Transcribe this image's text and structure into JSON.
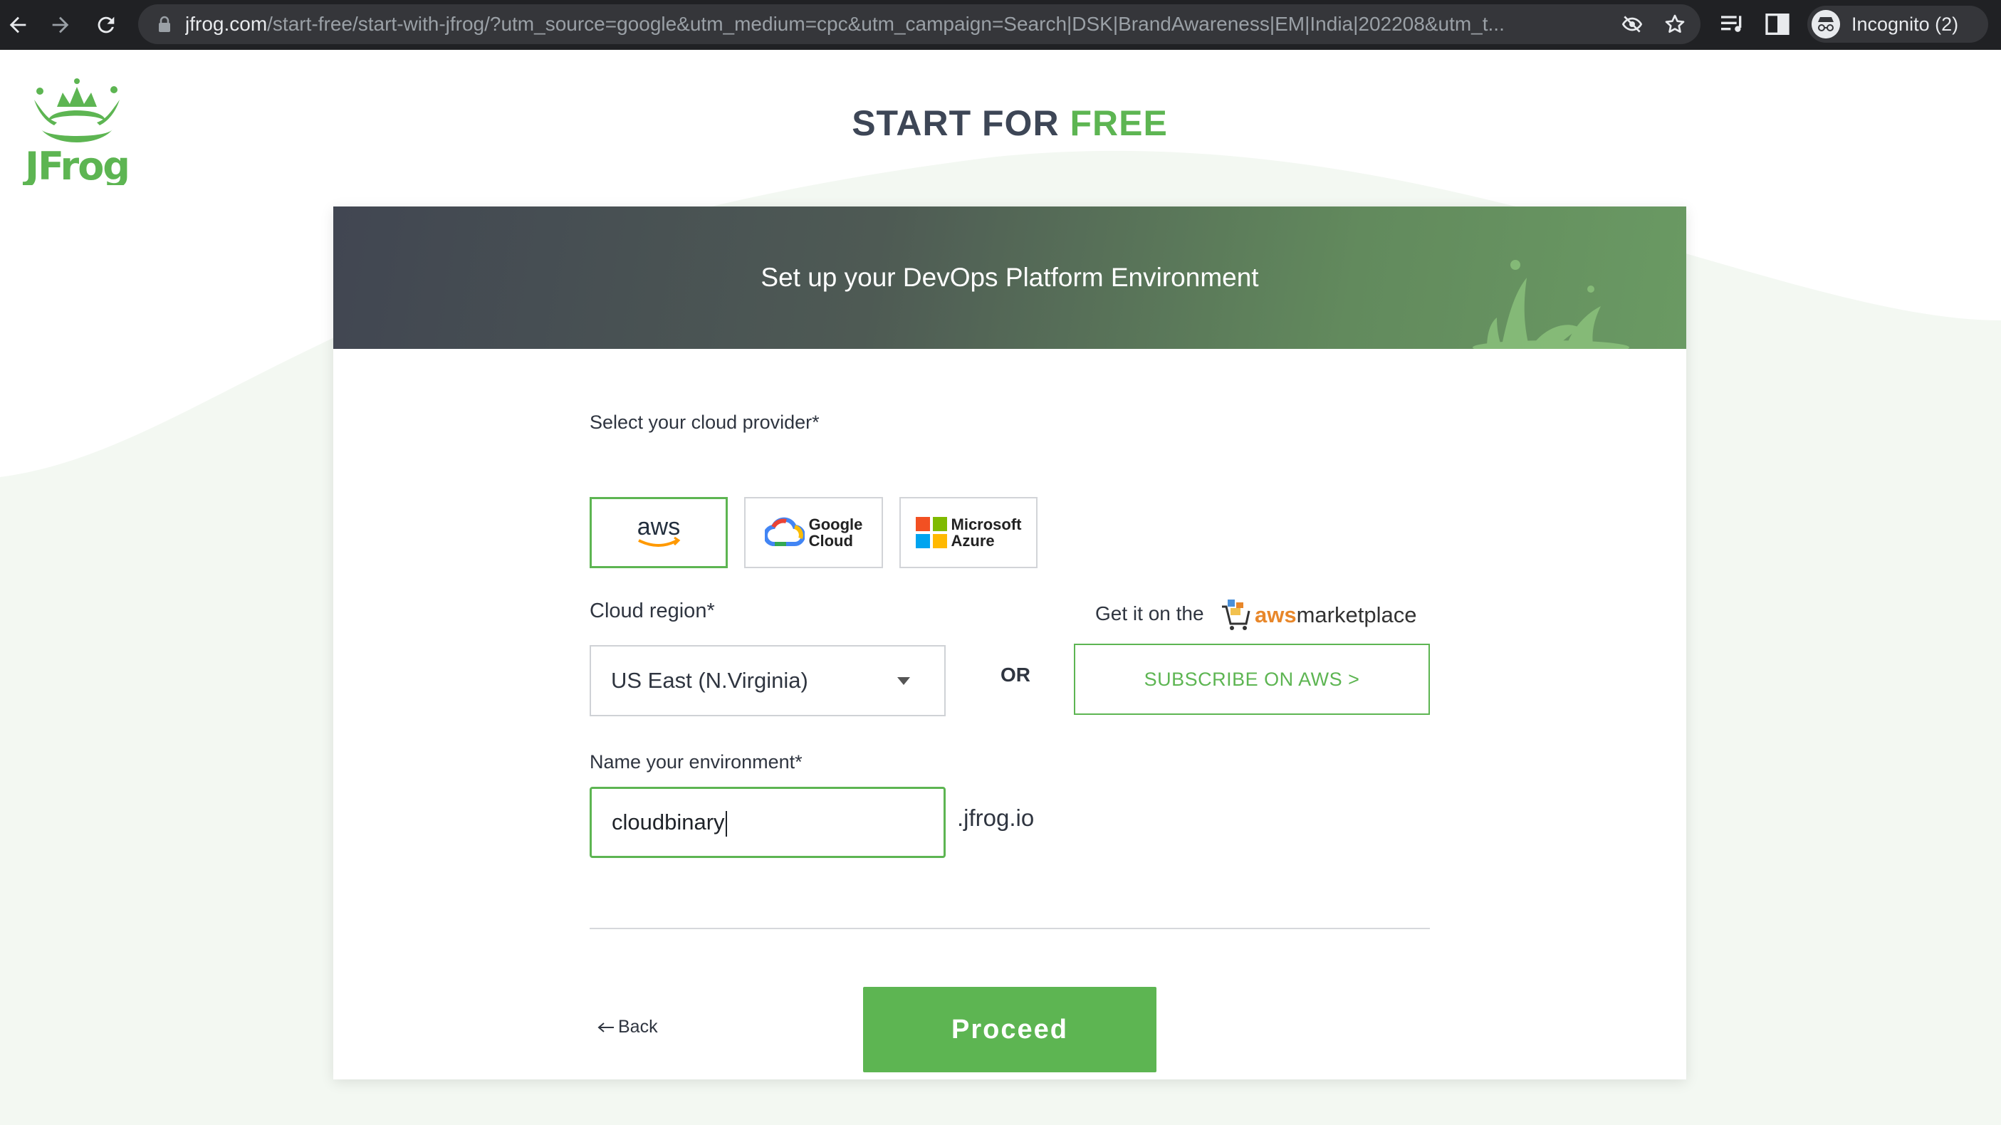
{
  "browser": {
    "url_host": "jfrog.com",
    "url_path": "/start-free/start-with-jfrog/?utm_source=google&utm_medium=cpc&utm_campaign=Search|DSK|BrandAwareness|EM|India|202208&utm_t...",
    "profile_label": "Incognito (2)"
  },
  "header": {
    "logo_text": "JFrog",
    "title_part1": "START FOR ",
    "title_part2": "FREE"
  },
  "card": {
    "title": "Set up your DevOps Platform Environment"
  },
  "form": {
    "provider_label": "Select your cloud provider*",
    "providers": [
      {
        "name": "aws",
        "selected": true
      },
      {
        "line1": "Google",
        "line2": "Cloud",
        "selected": false
      },
      {
        "line1": "Microsoft",
        "line2": "Azure",
        "selected": false
      }
    ],
    "region_label": "Cloud region*",
    "region_value": "US East (N.Virginia)",
    "or_label": "OR",
    "marketplace_prefix": "Get it on the",
    "marketplace_aws": "aws",
    "marketplace_suffix": "marketplace",
    "subscribe_label": "SUBSCRIBE ON AWS  >",
    "env_label": "Name your environment*",
    "env_value": "cloudbinary",
    "env_suffix": ".jfrog.io",
    "back_label": "Back",
    "proceed_label": "Proceed"
  },
  "colors": {
    "brand_green": "#5db552",
    "heading_dark": "#3d4656",
    "chrome_dark": "#202124"
  }
}
